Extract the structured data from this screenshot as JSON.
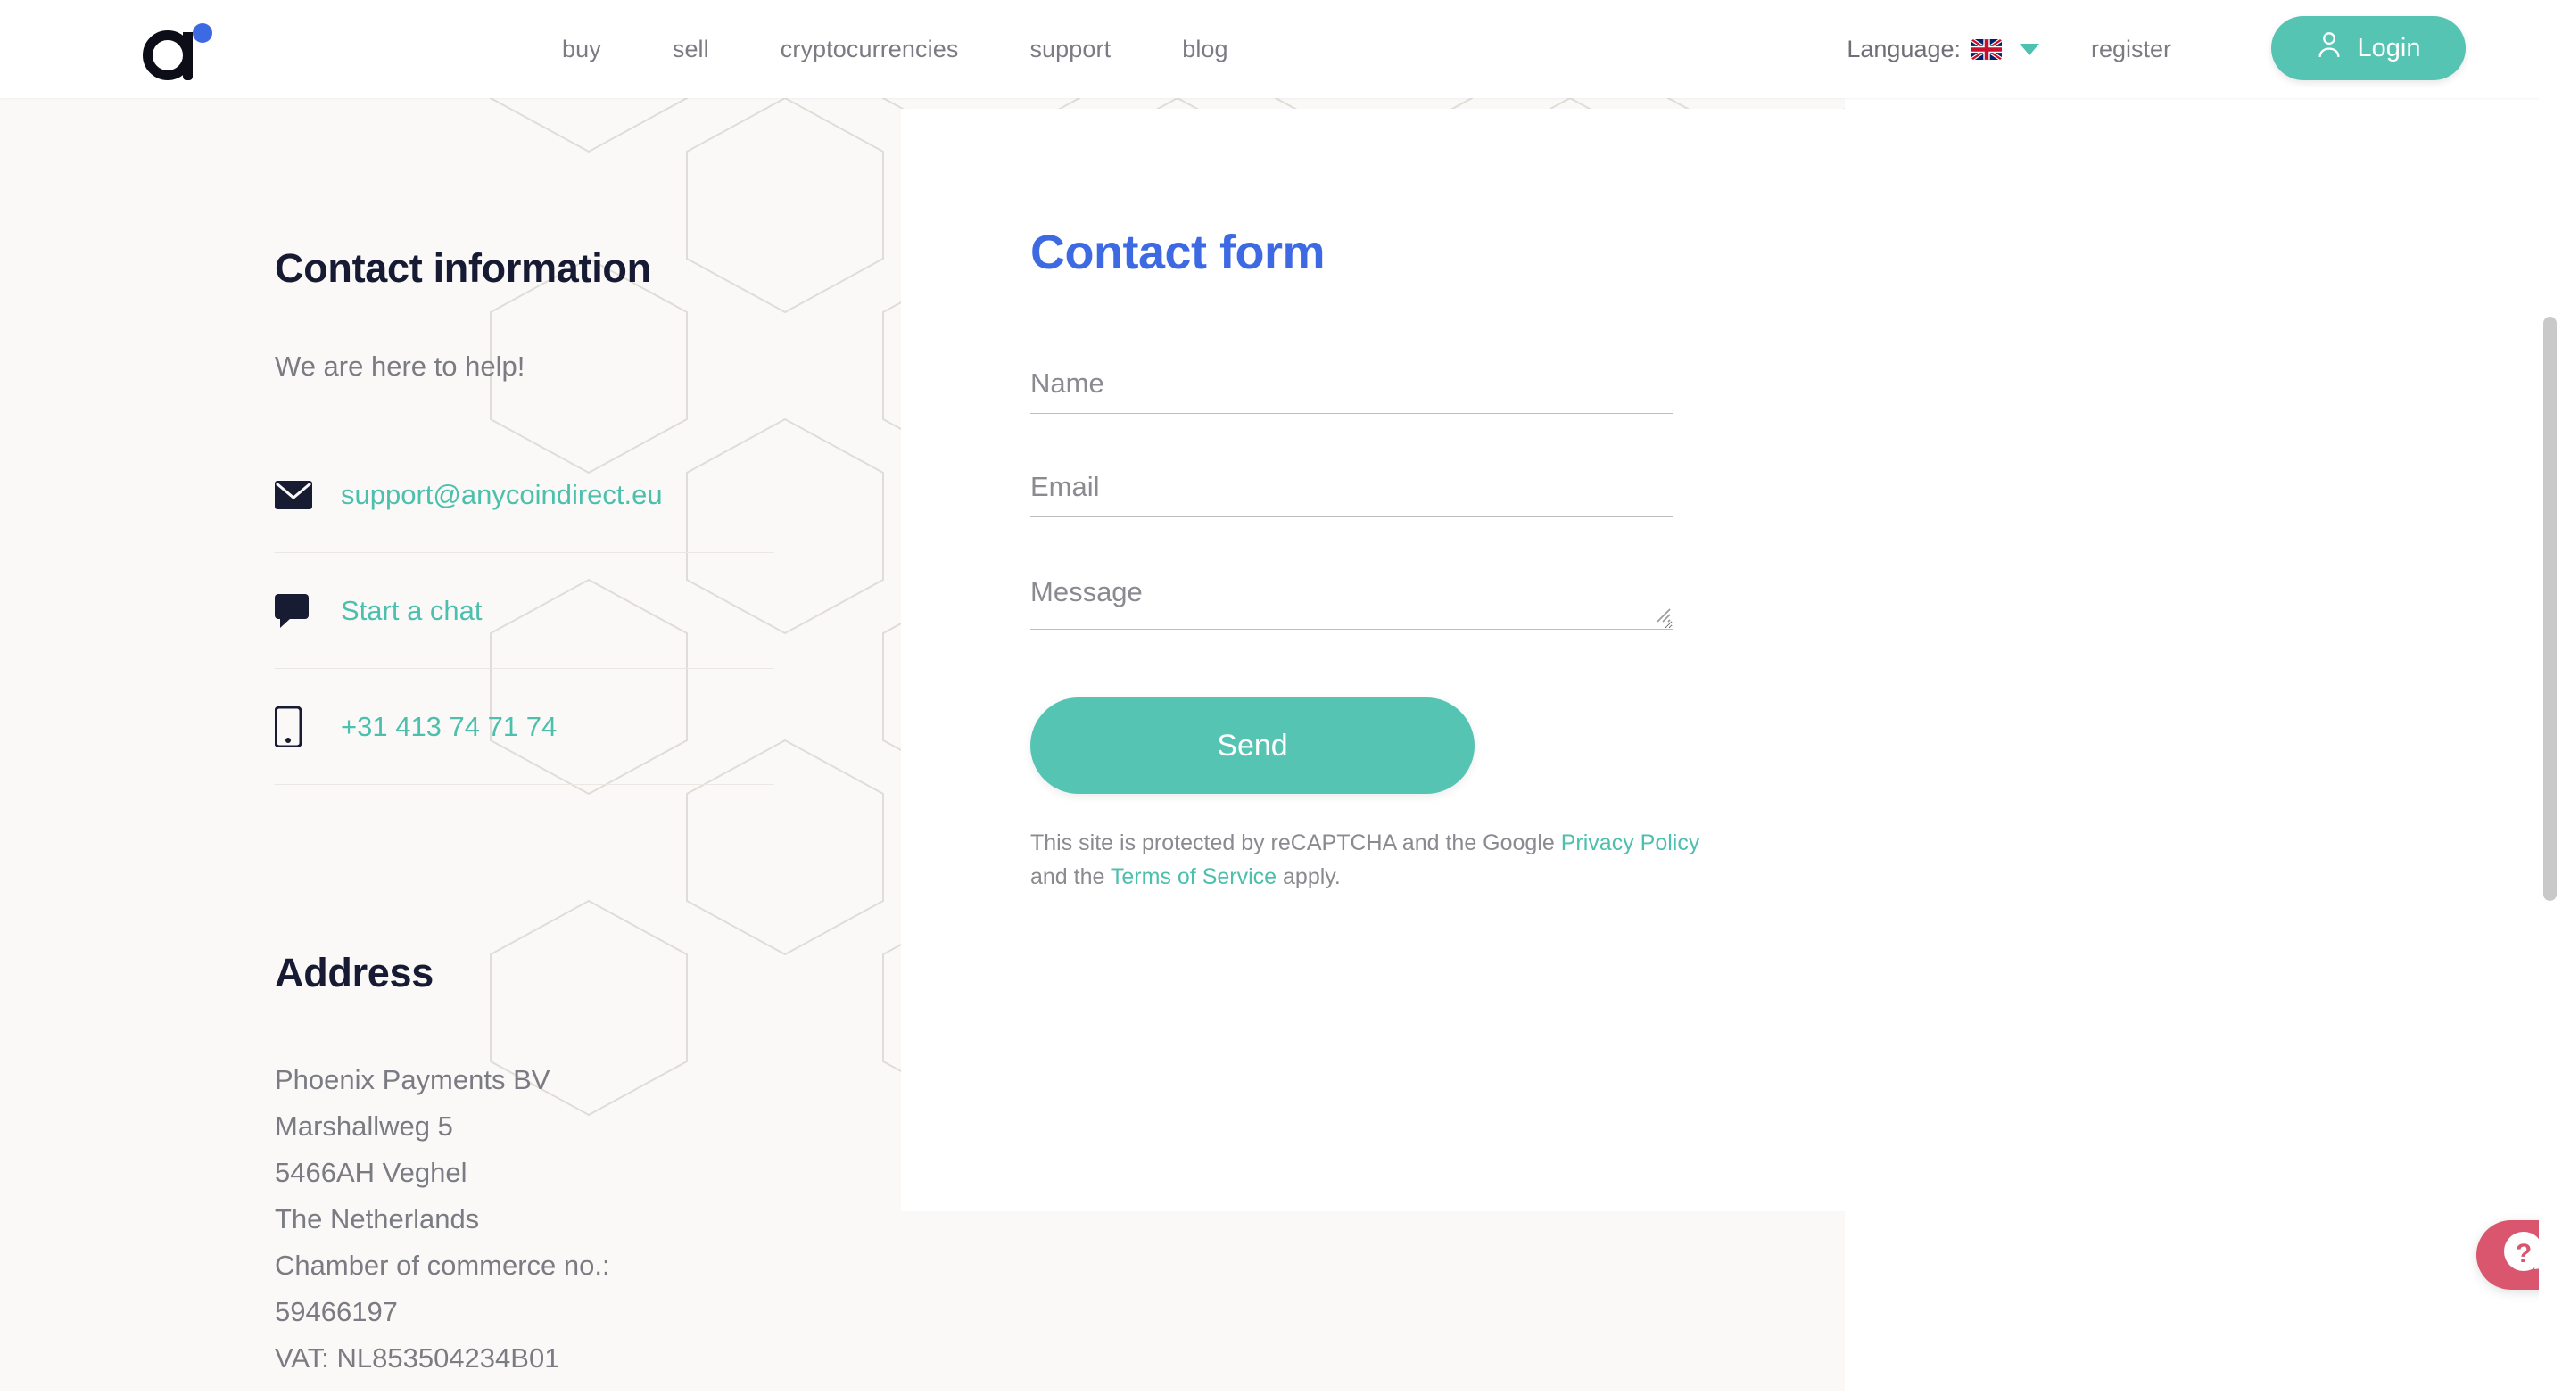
{
  "header": {
    "logo_name": "anycoin-direct-logo",
    "nav": [
      {
        "label": "buy"
      },
      {
        "label": "sell"
      },
      {
        "label": "cryptocurrencies"
      },
      {
        "label": "support"
      },
      {
        "label": "blog"
      }
    ],
    "language_label": "Language:",
    "language_flag": "uk-flag",
    "register_label": "register",
    "login_label": "Login"
  },
  "contact": {
    "title": "Contact information",
    "subtitle": "We are here to help!",
    "rows": [
      {
        "icon": "envelope-icon",
        "label": "support@anycoindirect.eu"
      },
      {
        "icon": "chat-bubble-icon",
        "label": "Start a chat"
      },
      {
        "icon": "mobile-phone-icon",
        "label": "+31 413 74 71 74"
      }
    ],
    "address_title": "Address",
    "address_lines": [
      "Phoenix Payments BV",
      "Marshallweg 5",
      "5466AH Veghel",
      "The Netherlands",
      "Chamber of commerce no.:",
      "59466197",
      "VAT: NL853504234B01"
    ]
  },
  "form": {
    "title": "Contact form",
    "name_placeholder": "Name",
    "name_value": "",
    "email_placeholder": "Email",
    "email_value": "",
    "message_placeholder": "Message",
    "message_value": "",
    "send_label": "Send",
    "recaptcha_prefix": "This site is protected by reCAPTCHA and the Google ",
    "privacy_policy_label": "Privacy Policy",
    "recaptcha_middle": " and the ",
    "terms_label": "Terms of Service",
    "recaptcha_suffix": " apply."
  },
  "help_widget": {
    "glyph": "?"
  },
  "colors": {
    "teal": "#55c4b2",
    "link_teal": "#4cbfad",
    "blue": "#3d6ae3",
    "dark": "#161a32",
    "muted": "#7b7b83",
    "bg": "#faf9f7",
    "help_pink": "#d9566e"
  }
}
